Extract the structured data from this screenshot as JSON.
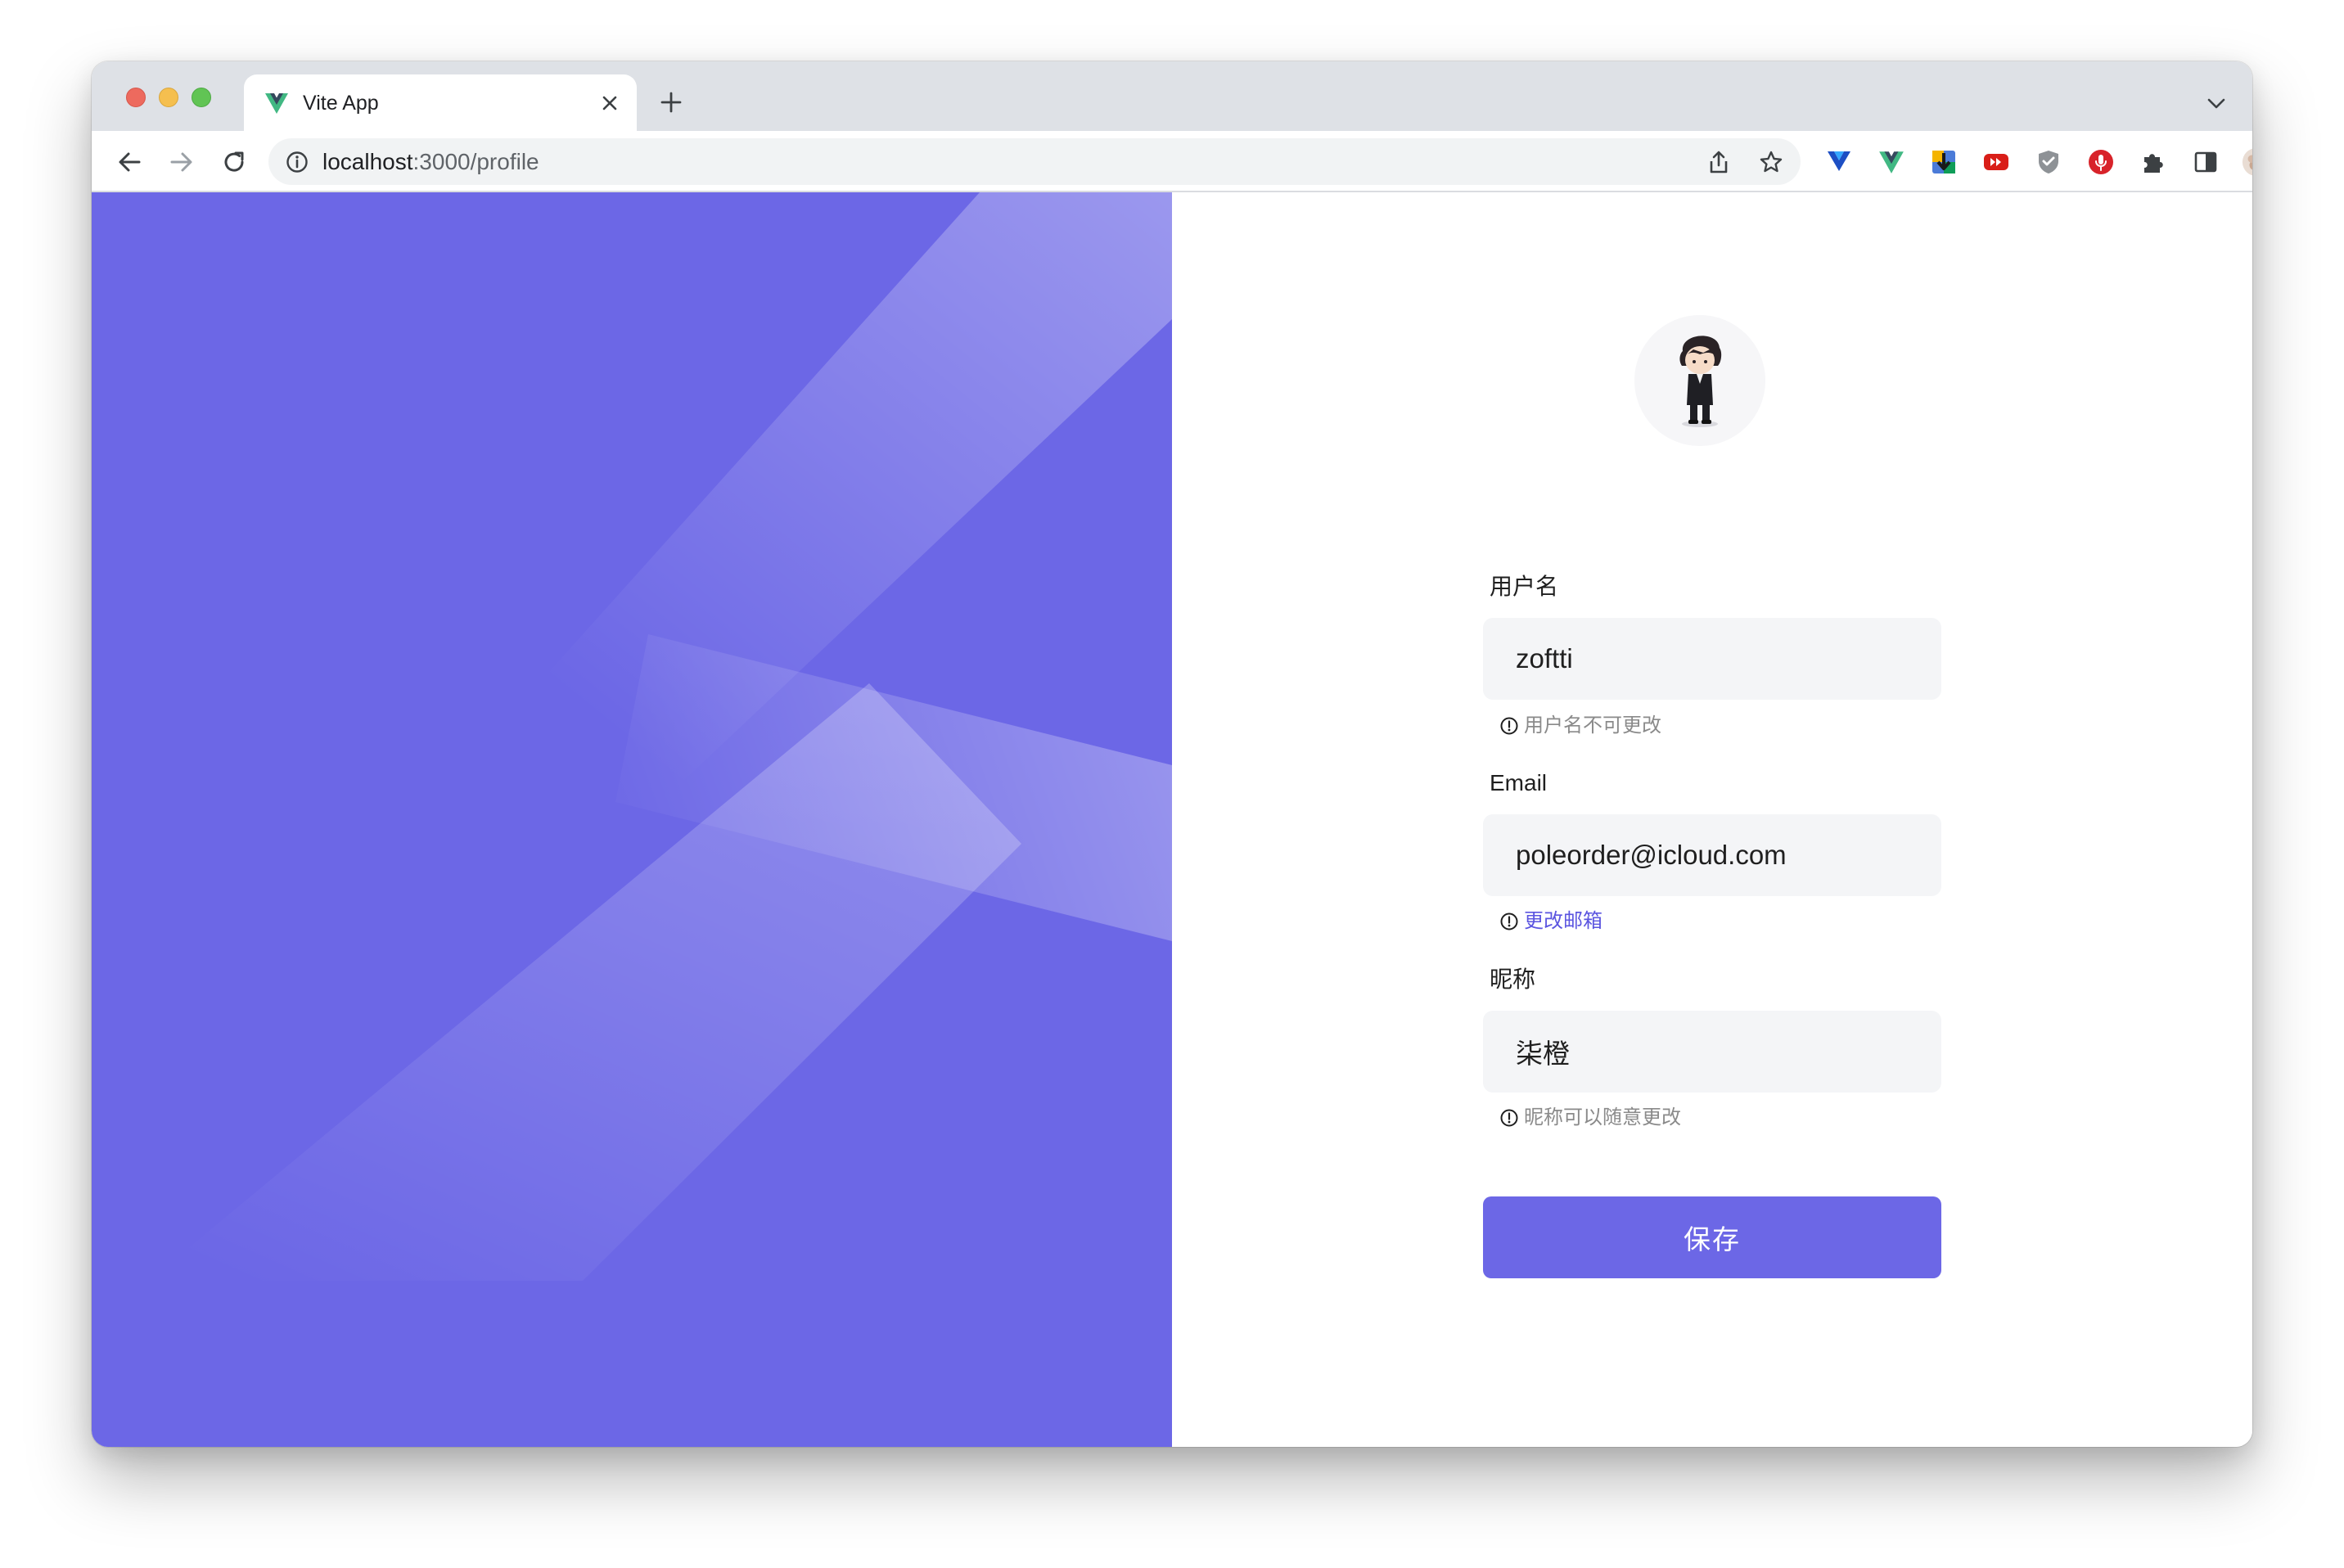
{
  "browser": {
    "tab": {
      "title": "Vite App"
    },
    "address": {
      "host": "localhost",
      "path": ":3000/profile"
    }
  },
  "avatar": {
    "alt": "user avatar"
  },
  "form": {
    "username": {
      "label": "用户名",
      "value": "zoftti",
      "hint": "用户名不可更改"
    },
    "email": {
      "label": "Email",
      "value": "poleorder@icloud.com",
      "hint": "更改邮箱"
    },
    "nickname": {
      "label": "昵称",
      "value": "柒橙",
      "hint": "昵称可以随意更改"
    },
    "save_label": "保存"
  },
  "colors": {
    "brand": "#6c67e6",
    "link": "#5b55e0",
    "input_bg": "#f4f5f7"
  }
}
